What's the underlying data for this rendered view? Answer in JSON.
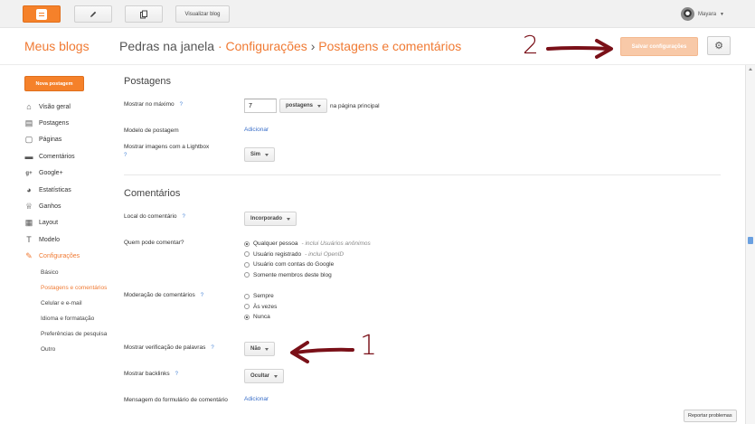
{
  "topbar": {
    "view_blog": "Visualizar blog",
    "user_name": "Mayara"
  },
  "header": {
    "my_blogs": "Meus blogs",
    "blog_name": "Pedras na janela",
    "sep1": "·",
    "crumb1": "Configurações",
    "sep2": "›",
    "crumb2": "Postagens e comentários",
    "save_button": "Salvar configurações"
  },
  "annotations": {
    "num_2": "2",
    "num_1": "1",
    "color": "#7a1018"
  },
  "sidebar": {
    "new_post": "Nova postagem",
    "items": [
      {
        "label": "Visão geral",
        "icon": "home-icon"
      },
      {
        "label": "Postagens",
        "icon": "posts-icon"
      },
      {
        "label": "Páginas",
        "icon": "pages-icon"
      },
      {
        "label": "Comentários",
        "icon": "comments-icon"
      },
      {
        "label": "Google+",
        "icon": "google-plus-icon"
      },
      {
        "label": "Estatísticas",
        "icon": "stats-icon"
      },
      {
        "label": "Ganhos",
        "icon": "trophy-icon"
      },
      {
        "label": "Layout",
        "icon": "layout-icon"
      },
      {
        "label": "Modelo",
        "icon": "template-icon"
      },
      {
        "label": "Configurações",
        "icon": "wrench-icon"
      }
    ],
    "subitems": [
      "Básico",
      "Postagens e comentários",
      "Celular e e-mail",
      "Idioma e formatação",
      "Preferências de pesquisa",
      "Outro"
    ]
  },
  "postagens": {
    "title": "Postagens",
    "max_label": "Mostrar no máximo",
    "max_value": "7",
    "max_unit": "postagens",
    "max_suffix": "na página principal",
    "template_label": "Modelo de postagem",
    "template_link": "Adicionar",
    "lightbox_label": "Mostrar imagens com a Lightbox",
    "lightbox_value": "Sim",
    "help": "?"
  },
  "comentarios": {
    "title": "Comentários",
    "location_label": "Local do comentário",
    "location_value": "Incorporado",
    "who_label": "Quem pode comentar?",
    "who_options": [
      {
        "label": "Qualquer pessoa",
        "hint": " - inclui Usuários anônimos"
      },
      {
        "label": "Usuário registrado",
        "hint": " - inclui OpenID"
      },
      {
        "label": "Usuário com contas do Google",
        "hint": ""
      },
      {
        "label": "Somente membros deste blog",
        "hint": ""
      }
    ],
    "moderation_label": "Moderação de comentários",
    "moderation_options": [
      "Sempre",
      "Às vezes",
      "Nunca"
    ],
    "word_verif_label": "Mostrar verificação de palavras",
    "word_verif_value": "Não",
    "backlinks_label": "Mostrar backlinks",
    "backlinks_value": "Ocultar",
    "form_msg_label": "Mensagem do formulário de comentário",
    "form_msg_link": "Adicionar"
  },
  "footer": {
    "report": "Reportar problemas"
  },
  "colors": {
    "accent": "#f07a33",
    "link": "#3a6fc9"
  }
}
